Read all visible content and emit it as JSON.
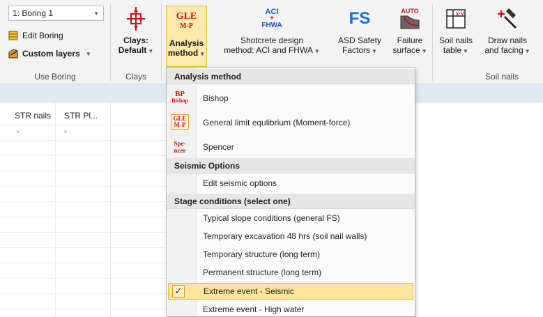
{
  "ribbon": {
    "boring_select": {
      "value": "1: Boring 1"
    },
    "edit_boring_label": "Edit Boring",
    "custom_layers_label": "Custom layers",
    "use_boring_group": "Use Boring",
    "clays_label_1": "Clays:",
    "clays_label_2": "Default",
    "clays_group": "Clays",
    "analysis_icon_1": "GLE",
    "analysis_icon_2": "M-P",
    "analysis_label_1": "Analysis",
    "analysis_label_2": "method",
    "shotcrete_icon_1": "ACI",
    "shotcrete_icon_2": "+",
    "shotcrete_icon_3": "FHWA",
    "shotcrete_label_1": "Shotcrete design",
    "shotcrete_label_2": "method: ACI and FHWA",
    "asd_icon": "FS",
    "asd_label_1": "ASD Safety",
    "asd_label_2": "Factors",
    "failure_icon": "AUTO",
    "failure_label_1": "Failure",
    "failure_label_2": "surface",
    "soil_nails_table_label_1": "Soil nails",
    "soil_nails_table_label_2": "table",
    "draw_nails_label_1": "Draw nails",
    "draw_nails_label_2": "and facing",
    "soil_nails_group": "Soil nails"
  },
  "grid": {
    "columns": [
      "STR nails",
      "STR Pl..."
    ],
    "rows": [
      [
        "-",
        "-"
      ]
    ]
  },
  "menu": {
    "header_analysis": "Analysis method",
    "bishop_icon_1": "BP",
    "bishop_icon_2": "Bishop",
    "bishop": "Bishop",
    "gle_icon_1": "GLE",
    "gle_icon_2": "M-P",
    "gle": "General limit equlibrium (Moment-force)",
    "spencer_icon_1": "Spe-",
    "spencer_icon_2": "ncer",
    "spencer": "Spencer",
    "header_seismic": "Seismic Options",
    "edit_seismic": "Edit seismic options",
    "header_stage": "Stage conditions (select one)",
    "stage_items": [
      "Typical slope conditions (general FS)",
      "Temporary excavation 48 hrs (soil nail walls)",
      "Temporary structure (long term)",
      "Permanent structure (long term)",
      "Extreme event - Seismic",
      "Extreme event - High water"
    ],
    "check_mark": "✓"
  },
  "colors": {
    "accent_red": "#c0141a",
    "active_highlight": "#fde9a8",
    "active_border": "#e9b339",
    "strip_blue": "#dfe9f5"
  }
}
